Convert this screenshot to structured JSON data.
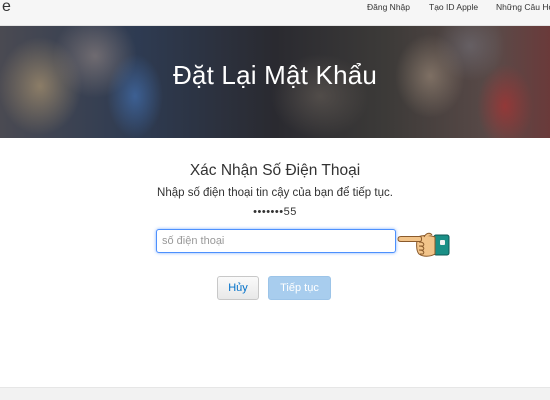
{
  "header": {
    "brand_letter": "e",
    "nav": [
      "Đăng Nhập",
      "Tạo ID Apple",
      "Những Câu Hỏi"
    ]
  },
  "hero": {
    "title": "Đặt Lại Mật Khẩu"
  },
  "form": {
    "title": "Xác Nhận Số Điện Thoại",
    "description": "Nhập số điện thoại tin cậy của bạn để tiếp tục.",
    "masked_number": "•••••••55",
    "phone_placeholder": "số điện thoại",
    "phone_value": ""
  },
  "buttons": {
    "cancel_label": "Hủy",
    "continue_label": "Tiếp tục"
  },
  "colors": {
    "accent": "#0070c9",
    "focus_border": "#4d90fe",
    "continue_disabled": "#a8cdee"
  },
  "icons": {
    "pointer": "pointing-hand-icon"
  }
}
